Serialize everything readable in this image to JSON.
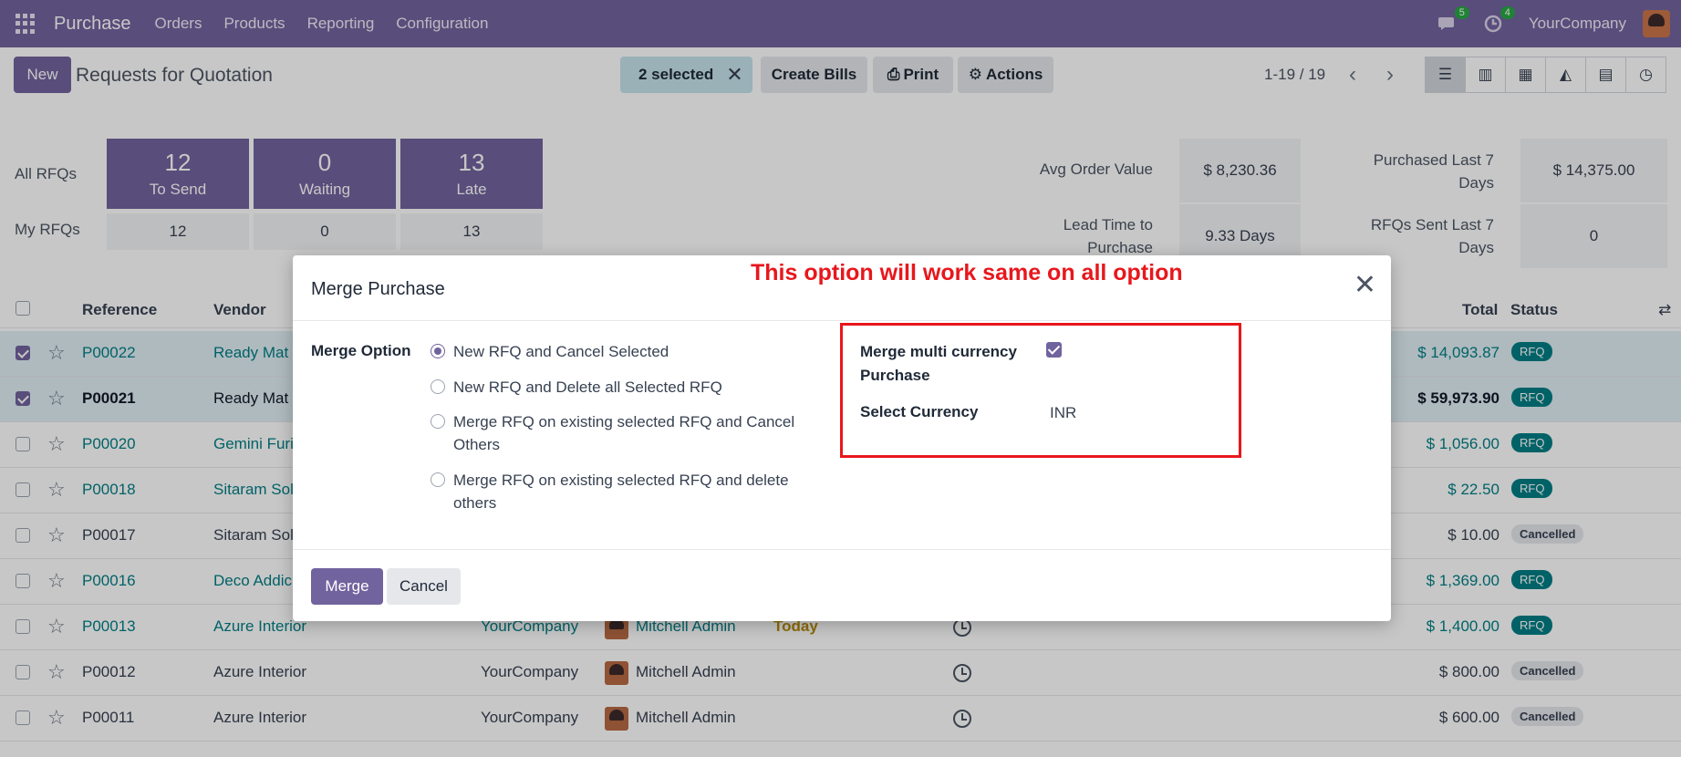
{
  "topnav": {
    "app_name": "Purchase",
    "menu": [
      "Orders",
      "Products",
      "Reporting",
      "Configuration"
    ],
    "messages_badge": "5",
    "activities_badge": "4",
    "company": "YourCompany",
    "accent": "#71639e"
  },
  "control": {
    "new_label": "New",
    "title": "Requests for Quotation",
    "selected_label": "2 selected",
    "create_bills": "Create Bills",
    "print": "Print",
    "actions": "Actions",
    "pager": "1-19 / 19",
    "views": [
      "list-icon",
      "kanban-icon",
      "pivot-icon",
      "graph-icon",
      "calendar-icon",
      "activity-icon"
    ]
  },
  "dashboard": {
    "all_rfqs": "All RFQs",
    "my_rfqs": "My RFQs",
    "tiles": [
      {
        "num": "12",
        "label": "To Send",
        "mine": "12"
      },
      {
        "num": "0",
        "label": "Waiting",
        "mine": "0"
      },
      {
        "num": "13",
        "label": "Late",
        "mine": "13"
      }
    ],
    "avg_order_label": "Avg Order Value",
    "avg_order_value": "$ 8,230.36",
    "purchased_label_1": "Purchased Last 7",
    "purchased_label_2": "Days",
    "purchased_value": "$ 14,375.00",
    "lead_label_1": "Lead Time to",
    "lead_label_2": "Purchase",
    "lead_value": "9.33 Days",
    "sent_label_1": "RFQs Sent Last 7",
    "sent_label_2": "Days",
    "sent_value": "0"
  },
  "table": {
    "headers": {
      "reference": "Reference",
      "vendor": "Vendor",
      "total": "Total",
      "status": "Status"
    },
    "rows": [
      {
        "ref": "P00022",
        "vendor": "Ready Mat",
        "company": "",
        "buyer": "",
        "deadline": "",
        "total": "$ 14,093.87",
        "status": "RFQ"
      },
      {
        "ref": "P00021",
        "vendor": "Ready Mat",
        "company": "",
        "buyer": "",
        "deadline": "",
        "total": "$ 59,973.90",
        "status": "RFQ"
      },
      {
        "ref": "P00020",
        "vendor": "Gemini Furi",
        "company": "",
        "buyer": "",
        "deadline": "",
        "total": "$ 1,056.00",
        "status": "RFQ"
      },
      {
        "ref": "P00018",
        "vendor": "Sitaram Sol",
        "company": "",
        "buyer": "",
        "deadline": "",
        "total": "$ 22.50",
        "status": "RFQ"
      },
      {
        "ref": "P00017",
        "vendor": "Sitaram Sol",
        "company": "",
        "buyer": "",
        "deadline": "",
        "total": "$ 10.00",
        "status": "Cancelled"
      },
      {
        "ref": "P00016",
        "vendor": "Deco Addic",
        "company": "",
        "buyer": "",
        "deadline": "",
        "total": "$ 1,369.00",
        "status": "RFQ"
      },
      {
        "ref": "P00013",
        "vendor": "Azure Interior",
        "company": "YourCompany",
        "buyer": "Mitchell Admin",
        "deadline": "Today",
        "total": "$ 1,400.00",
        "status": "RFQ"
      },
      {
        "ref": "P00012",
        "vendor": "Azure Interior",
        "company": "YourCompany",
        "buyer": "Mitchell Admin",
        "deadline": "",
        "total": "$ 800.00",
        "status": "Cancelled"
      },
      {
        "ref": "P00011",
        "vendor": "Azure Interior",
        "company": "YourCompany",
        "buyer": "Mitchell Admin",
        "deadline": "",
        "total": "$ 600.00",
        "status": "Cancelled"
      }
    ]
  },
  "modal": {
    "title": "Merge Purchase",
    "annotation": "This option will work same on all option",
    "merge_option_label": "Merge Option",
    "options": [
      "New RFQ and Cancel Selected",
      "New RFQ and Delete all Selected RFQ",
      "Merge RFQ on existing selected RFQ and Cancel Others",
      "Merge RFQ on existing selected RFQ and delete others"
    ],
    "selected_option": 0,
    "multi_currency_label_1": "Merge multi currency",
    "multi_currency_label_2": "Purchase",
    "multi_currency_checked": true,
    "select_currency_label": "Select Currency",
    "currency_value": "INR",
    "merge_button": "Merge",
    "cancel_button": "Cancel",
    "annotation_color": "#e8171c"
  }
}
